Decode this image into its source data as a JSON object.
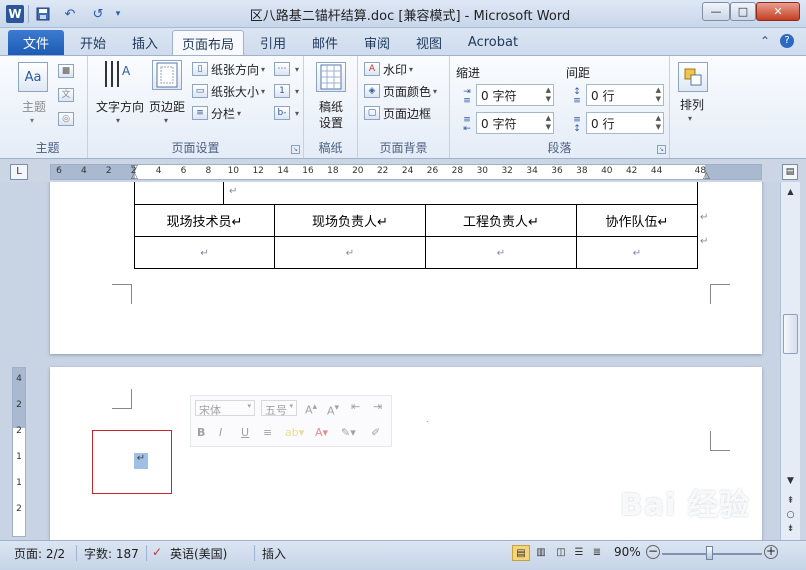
{
  "titlebar": {
    "app_icon_text": "W",
    "title": "区八路基二锚杆结算.doc [兼容模式] - Microsoft Word",
    "save_icon": "💾",
    "undo_icon": "↶",
    "redo_icon": "↺",
    "customize_icon": "▾",
    "min_icon": "—",
    "max_icon": "□",
    "close_icon": "✕"
  },
  "tabs": {
    "file": "文件",
    "home": "开始",
    "insert": "插入",
    "page_layout": "页面布局",
    "references": "引用",
    "mailings": "邮件",
    "review": "审阅",
    "view": "视图",
    "acrobat": "Acrobat",
    "collapse_icon": "⌃",
    "help_icon": "?"
  },
  "ribbon": {
    "themes": {
      "theme_label": "主题",
      "group_label": "主题",
      "colors_icon": "■",
      "fonts_icon": "文",
      "effects_icon": "◎"
    },
    "page_setup": {
      "text_direction": "文字方向",
      "margins": "页边距",
      "orientation": "纸张方向",
      "size": "纸张大小",
      "columns": "分栏",
      "group_label": "页面设置"
    },
    "draft": {
      "button": "稿纸\n设置",
      "button_line1": "稿纸",
      "button_line2": "设置",
      "group_label": "稿纸"
    },
    "page_background": {
      "watermark": "水印",
      "page_color": "页面颜色",
      "page_borders": "页面边框",
      "group_label": "页面背景"
    },
    "paragraph": {
      "indent_label": "缩进",
      "spacing_label": "间距",
      "indent_left": "0 字符",
      "indent_right": "0 字符",
      "spacing_before": "0 行",
      "spacing_after": "0 行",
      "group_label": "段落"
    },
    "arrange": {
      "label": "排列"
    }
  },
  "ruler": {
    "ticks": [
      "6",
      "4",
      "2",
      "2",
      "4",
      "6",
      "8",
      "10",
      "12",
      "14",
      "16",
      "18",
      "20",
      "22",
      "24",
      "26",
      "28",
      "30",
      "32",
      "34",
      "36",
      "38",
      "40",
      "42",
      "44",
      "48"
    ],
    "vticks": [
      "4",
      "2",
      "2",
      "1",
      "1",
      "2"
    ]
  },
  "document": {
    "table_headers": [
      "现场技术员↵",
      "现场负责人↵",
      "工程负责人↵",
      "协作队伍↵"
    ],
    "para_mark": "↵",
    "cursor_para": "↵"
  },
  "mini_toolbar": {
    "font": "宋体",
    "size": "五号"
  },
  "statusbar": {
    "page": "页面: 2/2",
    "words": "字数: 187",
    "language": "英语(美国)",
    "mode": "插入",
    "zoom": "90%"
  },
  "watermark_text": "Bai 经验"
}
